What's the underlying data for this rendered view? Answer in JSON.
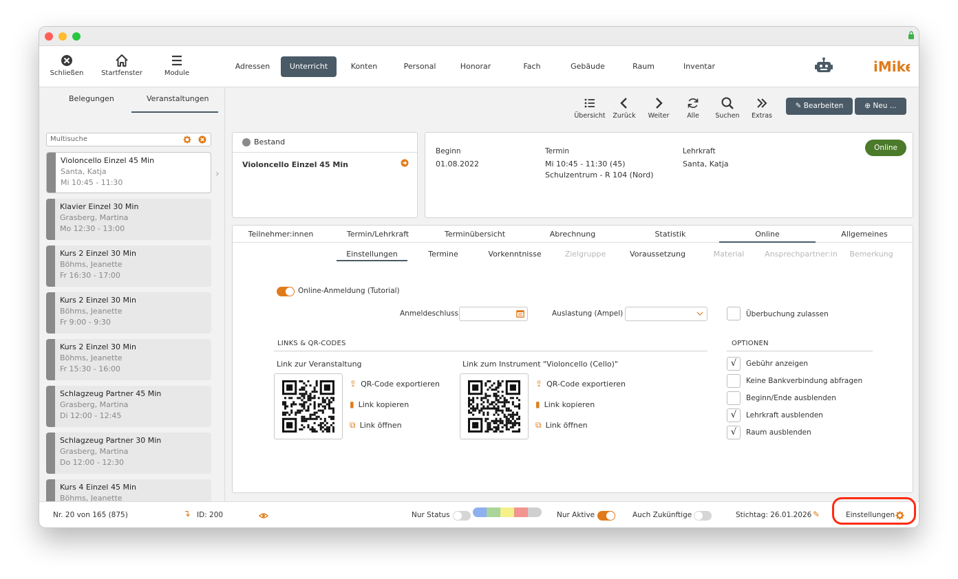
{
  "window": {
    "traffic_lights": {
      "close": "#fe5f57",
      "minimize": "#febc2e",
      "zoom": "#28c840"
    }
  },
  "toolbar": {
    "close_label": "Schließen",
    "start_label": "Startfenster",
    "modules_label": "Module",
    "nav": [
      "Adressen",
      "Unterricht",
      "Konten",
      "Personal",
      "Honorar",
      "Fach",
      "Gebäude",
      "Raum",
      "Inventar"
    ],
    "active_nav": "Unterricht",
    "logo_text": "iMikel"
  },
  "sidebar": {
    "tabs": [
      "Belegungen",
      "Veranstaltungen"
    ],
    "active_tab": "Veranstaltungen",
    "search_placeholder": "Multisuche",
    "items": [
      {
        "title": "Violoncello Einzel 45 Min",
        "teacher": "Santa, Katja",
        "time": "Mi 10:45 - 11:30"
      },
      {
        "title": "Klavier Einzel 30 Min",
        "teacher": "Grasberg, Martina",
        "time": "Mo 12:30 - 13:00"
      },
      {
        "title": "Kurs 2 Einzel 30 Min",
        "teacher": "Böhms, Jeanette",
        "time": "Fr 16:30 - 17:00"
      },
      {
        "title": "Kurs 2 Einzel 30 Min",
        "teacher": "Böhms, Jeanette",
        "time": "Fr 9:00 - 9:30"
      },
      {
        "title": "Kurs 2 Einzel 30 Min",
        "teacher": "Böhms, Jeanette",
        "time": "Fr 15:30 - 16:00"
      },
      {
        "title": "Schlagzeug Partner 45 Min",
        "teacher": "Grasberg, Martina",
        "time": "Di 12:00 - 12:45"
      },
      {
        "title": "Schlagzeug Partner 30 Min",
        "teacher": "Grasberg, Martina",
        "time": "Do 12:00 - 12:30"
      },
      {
        "title": "Kurs 4 Einzel 45 Min",
        "teacher": "Böhms, Jeanette",
        "time": ""
      }
    ]
  },
  "actions": {
    "overview": "Übersicht",
    "back": "Zurück",
    "forward": "Weiter",
    "all": "Alle",
    "search": "Suchen",
    "extras": "Extras",
    "edit": "Bearbeiten",
    "new": "Neu ..."
  },
  "record": {
    "status": "Bestand",
    "title": "Violoncello Einzel 45 Min",
    "beginn_label": "Beginn",
    "beginn_value": "01.08.2022",
    "termin_label": "Termin",
    "termin_value1": "Mi 10:45 - 11:30 (45)",
    "termin_value2": "Schulzentrum - R 104 (Nord)",
    "lehrkraft_label": "Lehrkraft",
    "lehrkraft_value": "Santa, Katja",
    "online_badge": "Online"
  },
  "tabs_main": [
    "Teilnehmer:innen",
    "Termin/Lehrkraft",
    "Terminübersicht",
    "Abrechnung",
    "Statistik",
    "Online",
    "Allgemeines"
  ],
  "tabs_sub": [
    "Einstellungen",
    "Termine",
    "Vorkenntnisse",
    "Zielgruppe",
    "Voraussetzung",
    "Material",
    "Ansprechpartner:in",
    "Bemerkung"
  ],
  "online": {
    "toggle_label": "Online-Anmeldung (Tutorial)",
    "toggle_on": true,
    "anmeldeschluss_label": "Anmeldeschluss",
    "auslastung_label": "Auslastung (Ampel)",
    "ueberbuchung_label": "Überbuchung zulassen",
    "links_heading": "LINKS & QR-CODES",
    "link1_heading": "Link zur Veranstaltung",
    "link2_heading": "Link zum Instrument \"Violoncello (Cello)\"",
    "export_label": "QR-Code exportieren",
    "copy_label": "Link kopieren",
    "open_label": "Link öffnen",
    "options_heading": "OPTIONEN",
    "options": [
      {
        "label": "Gebühr anzeigen",
        "checked": true
      },
      {
        "label": "Keine Bankverbindung abfragen",
        "checked": false
      },
      {
        "label": "Beginn/Ende ausblenden",
        "checked": false
      },
      {
        "label": "Lehrkraft ausblenden",
        "checked": true
      },
      {
        "label": "Raum ausblenden",
        "checked": true
      }
    ]
  },
  "footer": {
    "record_count": "Nr. 20 von 165 (875)",
    "id_label": "ID: 200",
    "nur_status": "Nur Status",
    "status_colors": [
      "#8fb0f0",
      "#a9d49a",
      "#f4f08a",
      "#f29490",
      "#cfcfcf"
    ],
    "nur_aktive": "Nur Aktive",
    "auch_zukuenftige": "Auch Zukünftige",
    "stichtag": "Stichtag: 26.01.2026",
    "settings": "Einstellungen"
  },
  "colors": {
    "accent": "#e07b1b",
    "primary": "#4a5a66",
    "online_green": "#4b7a2a",
    "highlight": "#ff2a12"
  }
}
